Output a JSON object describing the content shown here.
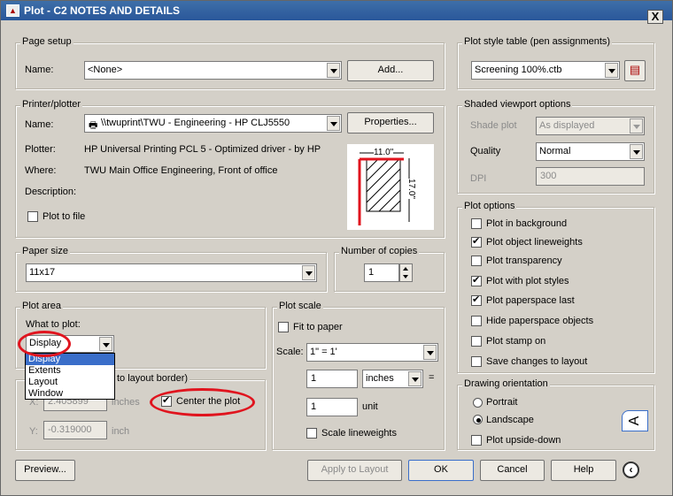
{
  "window": {
    "title": "Plot - C2 NOTES AND DETAILS",
    "close": "X"
  },
  "page_setup": {
    "group": "Page setup",
    "name_label": "Name:",
    "name_value": "<None>",
    "add_button": "Add..."
  },
  "printer": {
    "group": "Printer/plotter",
    "name_label": "Name:",
    "printer_value": "\\\\twuprint\\TWU - Engineering - HP CLJ5550",
    "properties_button": "Properties...",
    "plotter_label": "Plotter:",
    "plotter_value": "HP Universal Printing PCL 5 - Optimized driver - by HP",
    "where_label": "Where:",
    "where_value": "TWU Main Office Engineering, Front of office",
    "description_label": "Description:",
    "plot_to_file": "Plot to file",
    "preview_width": "11.0\"",
    "preview_height": "17.0\""
  },
  "paper_size": {
    "group": "Paper size",
    "value": "11x17"
  },
  "copies": {
    "group": "Number of copies",
    "value": "1"
  },
  "plot_area": {
    "group": "Plot area",
    "what_label": "What to plot:",
    "value": "Display",
    "options": [
      "Display",
      "Extents",
      "Layout",
      "Window"
    ]
  },
  "plot_offset": {
    "group_visible": "to layout border)",
    "x_label": "X:",
    "x_value": "2.405899",
    "x_unit": "inches",
    "y_label": "Y:",
    "y_value": "-0.319000",
    "y_unit": "inch",
    "center": "Center the plot"
  },
  "plot_scale": {
    "group": "Plot scale",
    "fit": "Fit to paper",
    "scale_label": "Scale:",
    "scale_value": "1\" = 1'",
    "val1": "1",
    "unit1": "inches",
    "eq": "=",
    "val2": "1",
    "unit2": "unit",
    "lineweights": "Scale lineweights"
  },
  "plot_style": {
    "group": "Plot style table (pen assignments)",
    "value": "Screening 100%.ctb"
  },
  "shaded": {
    "group": "Shaded viewport options",
    "shade_label": "Shade plot",
    "shade_value": "As displayed",
    "quality_label": "Quality",
    "quality_value": "Normal",
    "dpi_label": "DPI",
    "dpi_value": "300"
  },
  "plot_options": {
    "group": "Plot options",
    "items": [
      {
        "label": "Plot in background",
        "checked": false
      },
      {
        "label": "Plot object lineweights",
        "checked": true
      },
      {
        "label": "Plot transparency",
        "checked": false
      },
      {
        "label": "Plot with plot styles",
        "checked": true
      },
      {
        "label": "Plot paperspace last",
        "checked": true
      },
      {
        "label": "Hide paperspace objects",
        "checked": false
      },
      {
        "label": "Plot stamp on",
        "checked": false
      },
      {
        "label": "Save changes to layout",
        "checked": false
      }
    ]
  },
  "orientation": {
    "group": "Drawing orientation",
    "portrait": "Portrait",
    "landscape": "Landscape",
    "upside": "Plot upside-down",
    "icon": "A"
  },
  "footer": {
    "preview": "Preview...",
    "apply": "Apply to Layout",
    "ok": "OK",
    "cancel": "Cancel",
    "help": "Help"
  },
  "colors": {
    "title_bar": "#2a579a",
    "highlight_red": "#e0141e",
    "selection": "#3a6ec9"
  }
}
